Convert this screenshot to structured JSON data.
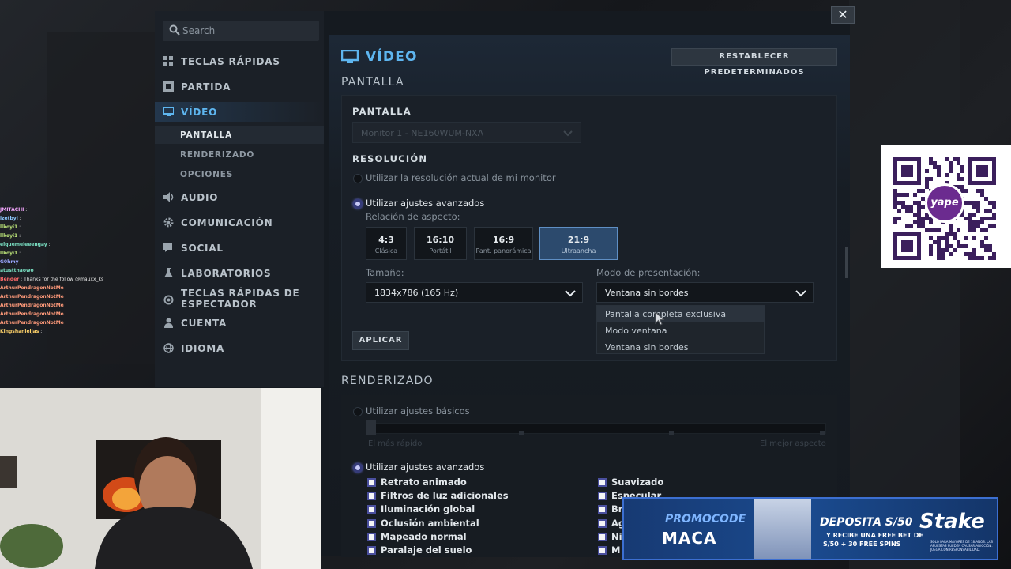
{
  "search": {
    "placeholder": "Search"
  },
  "sidebar": {
    "items": [
      {
        "label": "TECLAS RÁPIDAS"
      },
      {
        "label": "PARTIDA"
      },
      {
        "label": "VÍDEO"
      },
      {
        "label": "AUDIO"
      },
      {
        "label": "COMUNICACIÓN"
      },
      {
        "label": "SOCIAL"
      },
      {
        "label": "LABORATORIOS"
      },
      {
        "label": "TECLAS RÁPIDAS DE"
      },
      {
        "label": "CUENTA"
      },
      {
        "label": "IDIOMA"
      }
    ],
    "item7_line2": "ESPECTADOR",
    "video_sub": [
      "PANTALLA",
      "RENDERIZADO",
      "OPCIONES"
    ]
  },
  "main": {
    "title": "VÍDEO",
    "reset_label": "RESTABLECER PREDETERMINADOS",
    "section1": "PANTALLA",
    "pantalla_label": "PANTALLA",
    "monitor_value": "Monitor 1 - NE160WUM-NXA",
    "resolution_label": "RESOLUCIÓN",
    "res_option1": "Utilizar la resolución actual de mi monitor",
    "res_option2": "Utilizar ajustes avanzados",
    "aspect_label": "Relación de aspecto:",
    "ratios": [
      {
        "big": "4:3",
        "small": "Clásica"
      },
      {
        "big": "16:10",
        "small": "Portátil"
      },
      {
        "big": "16:9",
        "small": "Pant. panorámica"
      },
      {
        "big": "21:9",
        "small": "Ultraancha"
      }
    ],
    "size_label": "Tamaño:",
    "size_value": "1834x786 (165 Hz)",
    "mode_label": "Modo de presentación:",
    "mode_value": "Ventana sin bordes",
    "mode_options": [
      "Pantalla completa exclusiva",
      "Modo ventana",
      "Ventana sin bordes"
    ],
    "apply_label": "APLICAR",
    "section2": "RENDERIZADO",
    "render_basic": "Utilizar ajustes básicos",
    "slider_low": "El más rápido",
    "slider_high": "El mejor aspecto",
    "render_advanced": "Utilizar ajustes avanzados",
    "checks_left": [
      "Retrato animado",
      "Filtros de luz adicionales",
      "Iluminación global",
      "Oclusión ambiental",
      "Mapeado normal",
      "Paralaje del suelo"
    ],
    "checks_right": [
      "Suavizado",
      "Especular",
      "Br",
      "Ag",
      "Ni",
      "M"
    ]
  },
  "chat": [
    {
      "user": "JMITACHI",
      "msg": ""
    },
    {
      "user": "izetbyi",
      "msg": ""
    },
    {
      "user": "llkoyi1",
      "msg": ""
    },
    {
      "user": "llkoyi1",
      "msg": ""
    },
    {
      "user": "elquemeleeengay",
      "msg": ""
    },
    {
      "user": "llkoyi1",
      "msg": ""
    },
    {
      "user": "G0hmy",
      "msg": ""
    },
    {
      "user": "atusttnaowo",
      "msg": ""
    },
    {
      "user": "Bender",
      "msg": "Thanks for the follow @mauxx_ks"
    },
    {
      "user": "ArthurPendragonNotMe",
      "msg": ""
    },
    {
      "user": "ArthurPendragonNotMe",
      "msg": ""
    },
    {
      "user": "ArthurPendragonNotMe",
      "msg": ""
    },
    {
      "user": "ArthurPendragonNotMe",
      "msg": ""
    },
    {
      "user": "ArthurPendragonNotMe",
      "msg": ""
    },
    {
      "user": "Kingshanleljas",
      "msg": ""
    }
  ],
  "qr": {
    "badge": "yape"
  },
  "banner": {
    "promo": "PROMOCODE",
    "code": "MACA",
    "deposit": "DEPOSITA S/50",
    "line1": "Y RECIBE UNA FREE BET DE",
    "line2": "S/50 + 30 FREE SPINS",
    "brand": "Stake",
    "fine": "SOLO PARA MAYORES DE 18 AÑOS. LAS APUESTAS PUEDEN CAUSAR ADICCIÓN. JUEGA CON RESPONSABILIDAD."
  },
  "colors": {
    "accent": "#5eb6f0",
    "selected_ratio": "#2c4a6d",
    "radio_on": "#c7c9f6"
  }
}
